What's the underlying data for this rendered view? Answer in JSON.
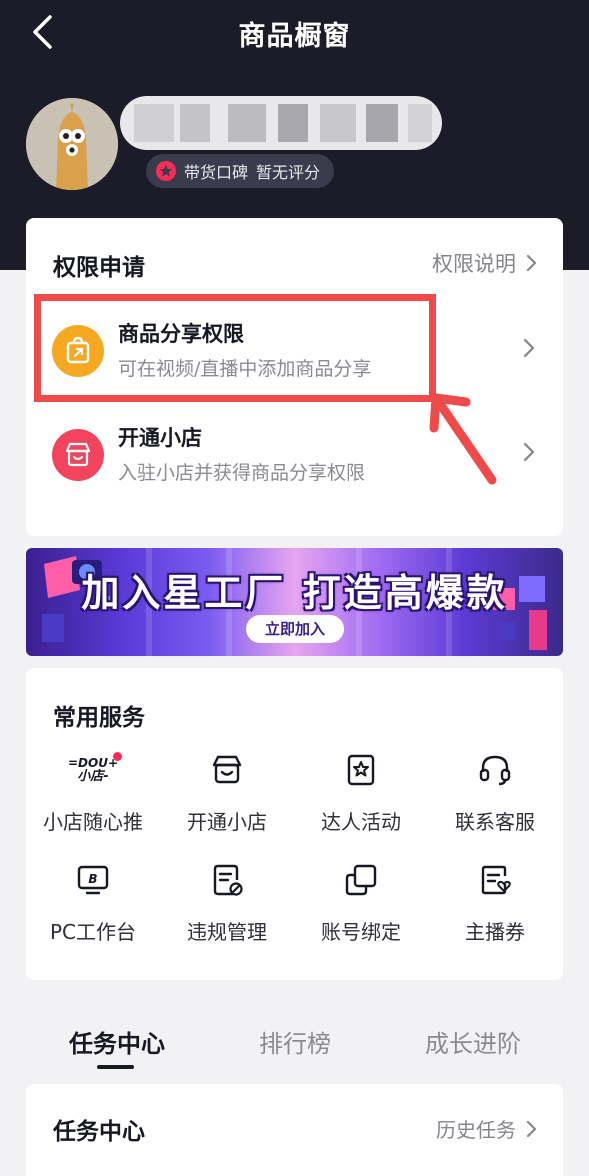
{
  "nav": {
    "title": "商品橱窗"
  },
  "profile": {
    "username": "",
    "rating_label": "带货口碑",
    "rating_value": "暂无评分"
  },
  "permissions": {
    "title": "权限申请",
    "explain_link": "权限说明",
    "items": [
      {
        "title": "商品分享权限",
        "desc": "可在视频/直播中添加商品分享",
        "icon": "share-box-icon",
        "color": "#f7a823"
      },
      {
        "title": "开通小店",
        "desc": "入驻小店并获得商品分享权限",
        "icon": "store-icon",
        "color": "#f2455d"
      }
    ]
  },
  "banner": {
    "text": "加入星工厂  打造高爆款",
    "button": "立即加入"
  },
  "services": {
    "title": "常用服务",
    "dou_plus_logo": "DOU+\n小店",
    "items": [
      {
        "label": "小店随心推",
        "icon": "dou-plus-shop-icon"
      },
      {
        "label": "开通小店",
        "icon": "store-icon"
      },
      {
        "label": "达人活动",
        "icon": "star-badge-icon"
      },
      {
        "label": "联系客服",
        "icon": "headset-icon"
      },
      {
        "label": "PC工作台",
        "icon": "monitor-icon"
      },
      {
        "label": "违规管理",
        "icon": "document-block-icon"
      },
      {
        "label": "账号绑定",
        "icon": "link-squares-icon"
      },
      {
        "label": "主播券",
        "icon": "coupon-icon"
      }
    ]
  },
  "tabs": {
    "items": [
      "任务中心",
      "排行榜",
      "成长进阶"
    ],
    "active": "任务中心"
  },
  "task": {
    "title": "任务中心",
    "history_link": "历史任务"
  },
  "colors": {
    "header_bg": "#1b1c28",
    "highlight": "#ee4a4a",
    "accent_red": "#fe2c55"
  }
}
